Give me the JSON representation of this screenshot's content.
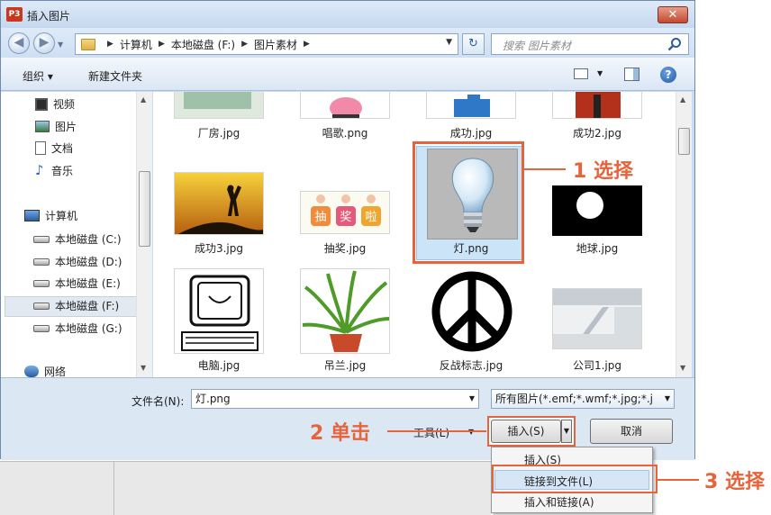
{
  "window": {
    "app_icon": "P3",
    "title": "插入图片",
    "close_icon": "close-icon"
  },
  "nav": {
    "breadcrumbs": [
      "计算机",
      "本地磁盘 (F:)",
      "图片素材"
    ],
    "search_placeholder": "搜索 图片素材"
  },
  "toolbar": {
    "organize": "组织 ▾",
    "new_folder": "新建文件夹"
  },
  "sidebar": {
    "items": [
      {
        "label": "视频",
        "icon": "video-icon"
      },
      {
        "label": "图片",
        "icon": "pictures-icon"
      },
      {
        "label": "文档",
        "icon": "documents-icon"
      },
      {
        "label": "音乐",
        "icon": "music-icon"
      },
      {
        "label": "计算机",
        "icon": "computer-icon"
      },
      {
        "label": "本地磁盘 (C:)",
        "icon": "drive-icon"
      },
      {
        "label": "本地磁盘 (D:)",
        "icon": "drive-icon"
      },
      {
        "label": "本地磁盘 (E:)",
        "icon": "drive-icon"
      },
      {
        "label": "本地磁盘 (F:)",
        "icon": "drive-icon",
        "selected": true
      },
      {
        "label": "本地磁盘 (G:)",
        "icon": "drive-icon"
      },
      {
        "label": "网络",
        "icon": "network-icon"
      }
    ]
  },
  "files": [
    {
      "name": "厂房.jpg"
    },
    {
      "name": "唱歌.png"
    },
    {
      "name": "成功.jpg"
    },
    {
      "name": "成功2.jpg"
    },
    {
      "name": "成功3.jpg"
    },
    {
      "name": "抽奖.jpg",
      "thumb_text": [
        "抽",
        "奖",
        "啦"
      ]
    },
    {
      "name": "灯.png",
      "selected": true
    },
    {
      "name": "地球.jpg"
    },
    {
      "name": "电脑.jpg"
    },
    {
      "name": "吊兰.jpg"
    },
    {
      "name": "反战标志.jpg"
    },
    {
      "name": "公司1.jpg"
    }
  ],
  "footer": {
    "filename_label": "文件名(N):",
    "filename_value": "灯.png",
    "filetype_value": "所有图片(*.emf;*.wmf;*.jpg;*.j",
    "tools_label": "工具(L)",
    "insert_label": "插入(S)",
    "cancel_label": "取消"
  },
  "insert_menu": {
    "items": [
      "插入(S)",
      "链接到文件(L)",
      "插入和链接(A)"
    ]
  },
  "annotations": {
    "step1": "1 选择",
    "step2": "2 单击",
    "step3": "3 选择"
  },
  "colors": {
    "accent": "#e5643b",
    "selection": "#cce4f7"
  }
}
